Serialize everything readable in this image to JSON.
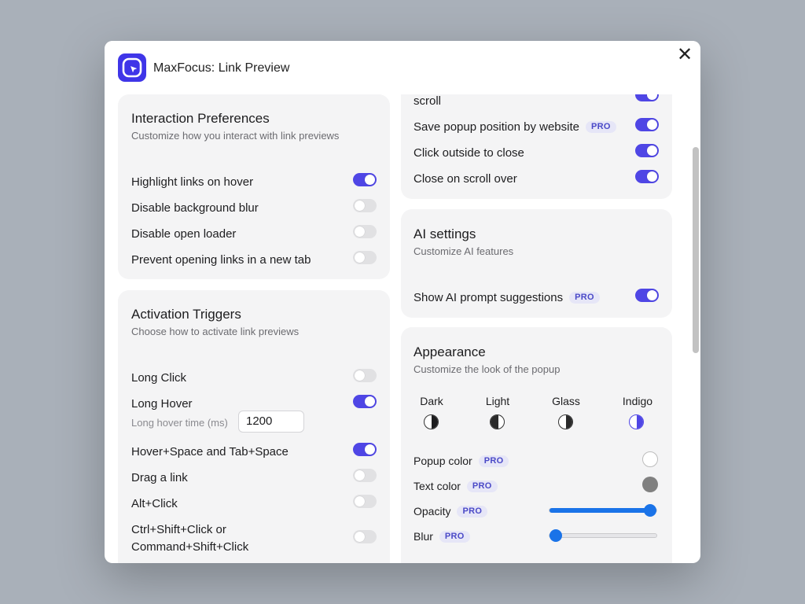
{
  "window": {
    "title": "MaxFocus: Link Preview",
    "close_label": "✕"
  },
  "pro_badge": "PRO",
  "interaction": {
    "title": "Interaction Preferences",
    "subtitle": "Customize how you interact with link previews",
    "items": [
      {
        "label": "Highlight links on hover",
        "on": true
      },
      {
        "label": "Disable background blur",
        "on": false
      },
      {
        "label": "Disable open loader",
        "on": false
      },
      {
        "label": "Prevent opening links in a new tab",
        "on": false
      }
    ]
  },
  "activation": {
    "title": "Activation Triggers",
    "subtitle": "Choose how to activate link previews",
    "long_click": {
      "label": "Long Click",
      "on": false
    },
    "long_hover": {
      "label": "Long Hover",
      "on": true
    },
    "hover_time": {
      "label": "Long hover time (ms)",
      "value": "1200"
    },
    "hover_space": {
      "label": "Hover+Space and Tab+Space",
      "on": true
    },
    "drag": {
      "label": "Drag a link",
      "on": false
    },
    "alt_click": {
      "label": "Alt+Click",
      "on": false
    },
    "ctrl_click": {
      "label_line1": "Ctrl+Shift+Click or",
      "label_line2": "Command+Shift+Click",
      "on": false
    }
  },
  "behavior": {
    "scroll_fragment": "scroll",
    "items": [
      {
        "label": "Save popup position by website",
        "pro": true,
        "on": true
      },
      {
        "label": "Click outside to close",
        "pro": false,
        "on": true
      },
      {
        "label": "Close on scroll over",
        "pro": false,
        "on": true
      }
    ]
  },
  "ai": {
    "title": "AI settings",
    "subtitle": "Customize AI features",
    "prompt_suggestions": {
      "label": "Show AI prompt suggestions",
      "pro": true,
      "on": true
    }
  },
  "appearance": {
    "title": "Appearance",
    "subtitle": "Customize the look of the popup",
    "themes": [
      {
        "label": "Dark",
        "color": "#1d1d1f"
      },
      {
        "label": "Light",
        "color": "#2a2a2a"
      },
      {
        "label": "Glass",
        "color": "#2a2a2a"
      },
      {
        "label": "Indigo",
        "color": "#4f46e5"
      }
    ],
    "popup_color": {
      "label": "Popup color",
      "value": "#ffffff"
    },
    "text_color": {
      "label": "Text color",
      "value": "#808080"
    },
    "opacity": {
      "label": "Opacity",
      "value": 1.0
    },
    "blur": {
      "label": "Blur",
      "value": 0.0
    }
  },
  "colors": {
    "accent": "#4f46e5",
    "slider": "#1a73e8"
  }
}
